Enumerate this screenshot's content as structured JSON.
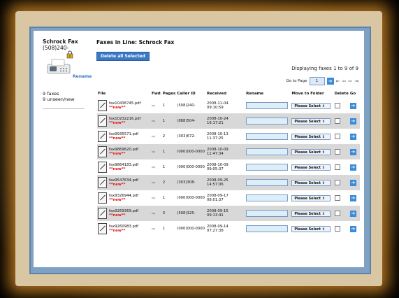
{
  "sidebar": {
    "fax_name": "Schrock Fax",
    "fax_number": "(508)240-",
    "rename_label": "Rename",
    "count": "9 faxes",
    "unseen": "9 unseen/new",
    "icons": [
      "fax-machine-icon",
      "lock-icon"
    ]
  },
  "main": {
    "title": "Faxes in Line: Schrock Fax",
    "delete_all_label": "Delete all Selected",
    "displaying": "Displaying faxes 1 to 9 of 9",
    "goto_label": "Go to Page",
    "goto_value": "1",
    "nav_icons": [
      "go-arrow-icon",
      "first-page-icon",
      "prev-page-icon",
      "next-page-icon",
      "last-page-icon"
    ]
  },
  "table": {
    "headers": [
      "File",
      "Fwd",
      "Pages",
      "Caller ID",
      "Received",
      "Rename",
      "Move to Folder",
      "Delete",
      "Go"
    ],
    "new_tag": "**new**",
    "select_label": "Please Select",
    "rows": [
      {
        "file": "fax10438745.pdf",
        "pages": "1",
        "caller": "(508)240-",
        "received": "2008-11-04 09:10:59"
      },
      {
        "file": "fax10232216.pdf",
        "pages": "1",
        "caller": "(888)504-",
        "received": "2008-10-24 16:17:21"
      },
      {
        "file": "fax9935571.pdf",
        "pages": "2",
        "caller": "(303)672-",
        "received": "2008-10-13 11:37:25"
      },
      {
        "file": "fax9869620.pdf",
        "pages": "1",
        "caller": "(000)000-0000",
        "received": "2008-10-09 11:47:34"
      },
      {
        "file": "fax9864183.pdf",
        "pages": "1",
        "caller": "(000)000-0000",
        "received": "2008-10-09 09:05:37"
      },
      {
        "file": "fax9547634.pdf",
        "pages": "2",
        "caller": "(303)308-",
        "received": "2008-09-25 14:57:06"
      },
      {
        "file": "fax9326944.pdf",
        "pages": "1",
        "caller": "(000)000-0000",
        "received": "2008-09-17 08:01:37"
      },
      {
        "file": "fax9269369.pdf",
        "pages": "3",
        "caller": "(508)325-",
        "received": "2008-09-15 09:13:41"
      },
      {
        "file": "fax9260983.pdf",
        "pages": "1",
        "caller": "(000)000-0000",
        "received": "2008-09-14 07:27:38"
      }
    ]
  }
}
